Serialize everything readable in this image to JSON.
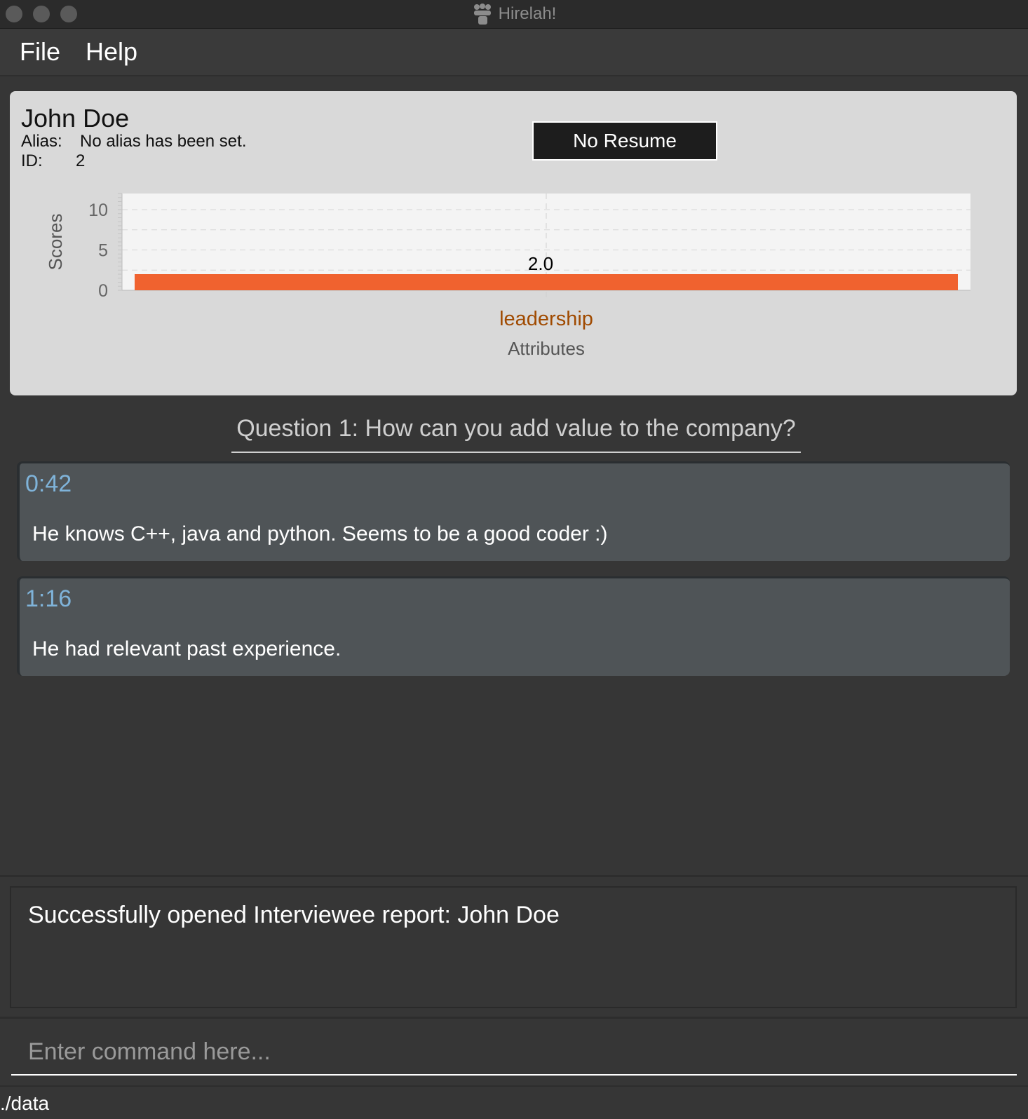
{
  "window": {
    "title": "Hirelah!",
    "icon": "people-group-icon"
  },
  "menu": {
    "items": [
      "File",
      "Help"
    ]
  },
  "interviewee": {
    "name": "John Doe",
    "alias_label": "Alias:",
    "alias_value": "No alias has been set.",
    "id_label": "ID:",
    "id_value": "2",
    "resume_button": "No Resume"
  },
  "chart_data": {
    "type": "bar",
    "categories": [
      "leadership"
    ],
    "values": [
      2.0
    ],
    "data_labels": [
      "2.0"
    ],
    "xlabel": "Attributes",
    "ylabel": "Scores",
    "ylim": [
      0,
      12
    ],
    "yticks": [
      0,
      5,
      10
    ],
    "grid": true,
    "bar_color": "#f0622f",
    "category_color": "#a04a00"
  },
  "question": {
    "text": "Question 1: How can you add  value to the company?"
  },
  "notes": [
    {
      "time": "0:42",
      "text": "He knows C++, java and python. Seems to be a good coder :)"
    },
    {
      "time": "1:16",
      "text": "He had relevant past experience."
    }
  ],
  "result": {
    "text": "Successfully opened Interviewee report: John Doe"
  },
  "command": {
    "placeholder": "Enter command here..."
  },
  "status": {
    "path": "./data"
  }
}
